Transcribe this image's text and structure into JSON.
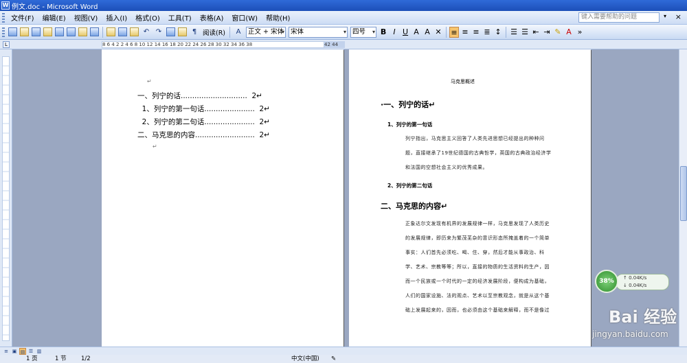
{
  "window": {
    "title": "例文.doc - Microsoft Word",
    "app_icon": "word-icon"
  },
  "menu": {
    "items": [
      "文件(F)",
      "编辑(E)",
      "视图(V)",
      "插入(I)",
      "格式(O)",
      "工具(T)",
      "表格(A)",
      "窗口(W)",
      "帮助(H)"
    ],
    "help_placeholder": "键入需要帮助的问题",
    "close_glyph": "×"
  },
  "toolbar": {
    "read_label": "阅读(R)",
    "style_value": "正文 + 宋体",
    "font_value": "宋体",
    "size_value": "四号",
    "bold": "B",
    "italic": "I",
    "underline": "U"
  },
  "ruler": {
    "ticks": "8   6   4   2        2   4   6   8  10  12  14  16  18  20  22  24  26  28  30  32  34  36  38",
    "right": "42  44  46"
  },
  "page1": {
    "toc": [
      {
        "text": "一、列宁的话.............................  2↵"
      },
      {
        "text": "  1、列宁的第一句话......................  2↵"
      },
      {
        "text": "  2、列宁的第二句话......................  2↵"
      },
      {
        "text": "二、马克思的内容..........................  2↵"
      }
    ],
    "para_mark": "↵"
  },
  "page2": {
    "header": "马克思概述",
    "h1_a": "·一、列宁的话↵",
    "h2_a": "1、列宁的第一句话",
    "para_a": "列宁指出，马克思主义回答了人类先进思想已经提出的种种问题，直接继承了19世纪德国的古典哲学，英国的古典政治经济学和法国的空想社会主义的优秀成果。",
    "h2_b": "2、列宁的第二句话",
    "h1_b": "二、马克思的内容↵",
    "para_b": "正象达尔文发现有机界的发展规律一样，马克思发现了人类历史的发展规律，即历来为繁茂芜杂的意识形态所掩盖着的一个简单事实：人们首先必须吃、喝、住、穿，然后才能从事政治、科学、艺术、宗教等等；所以，直接的物质的生活资料的生产，因而一个民族或一个时代的一定的经济发展阶段，便构成为基础，人们的国家设施、法的观点、艺术以至宗教观念，就是从这个基础上发展起来的，因而，也必须由这个基础来解释，而不是像过去那样做得相反。"
  },
  "speed_widget": {
    "percent": "38%",
    "up": "↑ 0.04K/s",
    "down": "↓ 0.04K/s"
  },
  "watermark": {
    "line1": "Bai 经验",
    "line2": "jingyan.baidu.com"
  },
  "status": {
    "page": "1 页",
    "section": "1 节",
    "pages": "1/2",
    "lang": "中文(中国)"
  }
}
